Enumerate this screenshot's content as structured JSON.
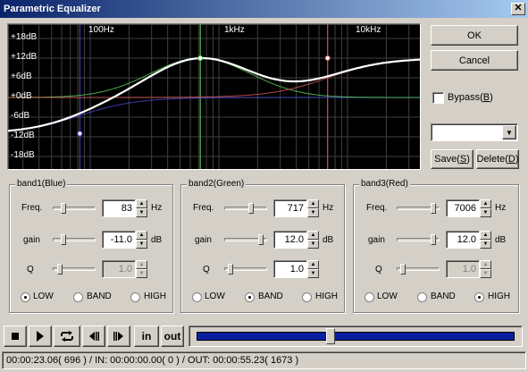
{
  "window": {
    "title": "Parametric Equalizer",
    "close_glyph": "✕"
  },
  "graph": {
    "db_labels": [
      "+18dB",
      "+12dB",
      "+6dB",
      "+0dB",
      "-6dB",
      "-12dB",
      "-18dB"
    ],
    "freq_labels": [
      "100Hz",
      "1kHz",
      "10kHz"
    ],
    "colors": {
      "background": "#000000",
      "curve": "#ffffff",
      "grid": "#404040",
      "band1": "#4a4ad8",
      "band2": "#5fd45f",
      "band3": "#e05a5a"
    }
  },
  "buttons": {
    "ok": "OK",
    "cancel": "Cancel",
    "save_pre": "Save(",
    "save_key": "S",
    "save_post": ")",
    "delete_pre": "Delete(",
    "delete_key": "D",
    "delete_post": ")"
  },
  "bypass": {
    "pre": "Bypass(",
    "key": "B",
    "post": ")",
    "checked": false
  },
  "preset": {
    "value": ""
  },
  "bands": [
    {
      "title": "band1(Blue)",
      "freq_label": "Freq.",
      "freq_value": "83",
      "freq_unit": "Hz",
      "gain_label": "gain",
      "gain_value": "-11.0",
      "gain_unit": "dB",
      "q_label": "Q",
      "q_value": "1.0",
      "q_enabled": false,
      "modes": [
        "LOW",
        "BAND",
        "HIGH"
      ],
      "selected_mode": "LOW"
    },
    {
      "title": "band2(Green)",
      "freq_label": "Freq.",
      "freq_value": "717",
      "freq_unit": "Hz",
      "gain_label": "gain",
      "gain_value": "12.0",
      "gain_unit": "dB",
      "q_label": "Q",
      "q_value": "1.0",
      "q_enabled": true,
      "modes": [
        "LOW",
        "BAND",
        "HIGH"
      ],
      "selected_mode": "BAND"
    },
    {
      "title": "band3(Red)",
      "freq_label": "Freq.",
      "freq_value": "7006",
      "freq_unit": "Hz",
      "gain_label": "gain",
      "gain_value": "12.0",
      "gain_unit": "dB",
      "q_label": "Q",
      "q_value": "1.0",
      "q_enabled": false,
      "modes": [
        "LOW",
        "BAND",
        "HIGH"
      ],
      "selected_mode": "HIGH"
    }
  ],
  "transport": {
    "icons": [
      "stop-icon",
      "play-icon",
      "loop-icon",
      "prev-frame-icon",
      "next-frame-icon"
    ],
    "in_label": "in",
    "out_label": "out",
    "seek_fraction": 0.42,
    "seek_color": "#0a1e9e"
  },
  "status": {
    "text": "00:00:23.06( 696 ) / IN: 00:00:00.00( 0 ) / OUT: 00:00:55.23( 1673 )"
  }
}
